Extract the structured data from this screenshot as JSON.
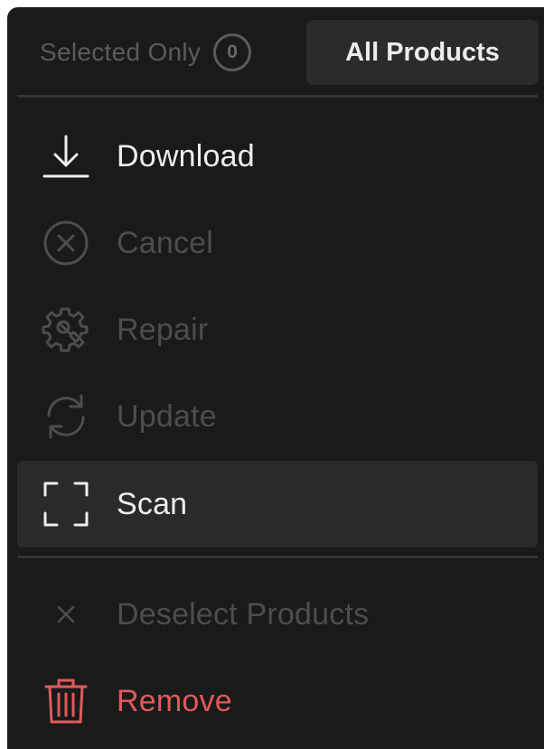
{
  "tabs": {
    "selected_only_label": "Selected Only",
    "selected_count": "0",
    "all_products_label": "All Products",
    "active_tab": "All Products"
  },
  "menu": {
    "download": {
      "label": "Download",
      "icon": "download-icon",
      "enabled": true
    },
    "cancel": {
      "label": "Cancel",
      "icon": "cancel-circle-icon",
      "enabled": false
    },
    "repair": {
      "label": "Repair",
      "icon": "repair-gear-wrench-icon",
      "enabled": false
    },
    "update": {
      "label": "Update",
      "icon": "refresh-icon",
      "enabled": false
    },
    "scan": {
      "label": "Scan",
      "icon": "scan-frame-icon",
      "enabled": true,
      "highlighted": true
    }
  },
  "actions": {
    "deselect": {
      "label": "Deselect Products",
      "icon": "close-x-icon",
      "enabled": false
    },
    "remove": {
      "label": "Remove",
      "icon": "trash-icon",
      "enabled": true
    }
  },
  "colors": {
    "background": "#1a1a1a",
    "highlight": "#2a2a2a",
    "text_enabled": "#eeeeee",
    "text_disabled": "#4d4d4d",
    "danger": "#e05a5a"
  }
}
